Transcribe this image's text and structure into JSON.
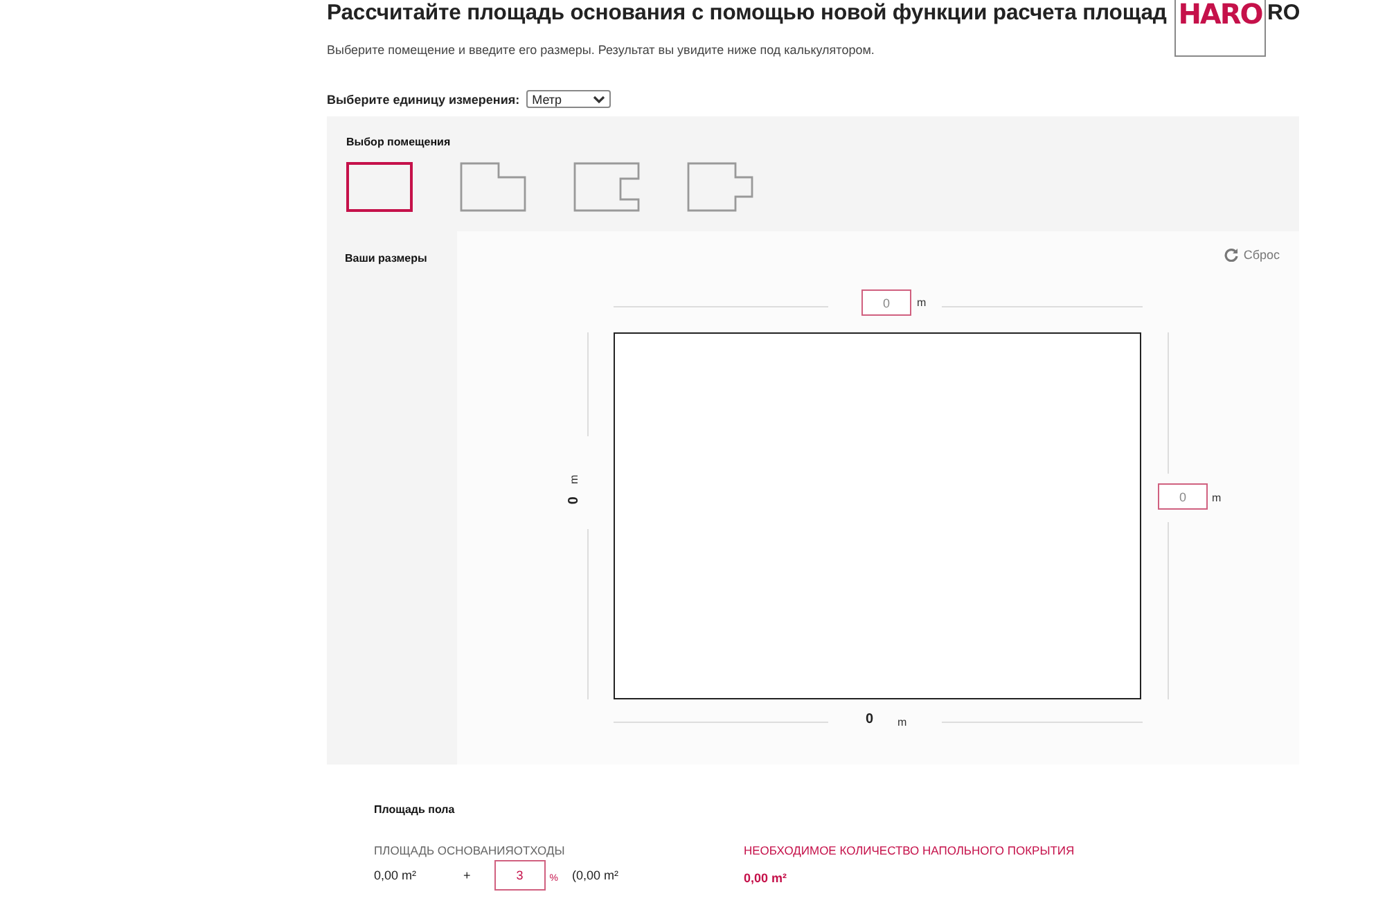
{
  "header": {
    "title": "Рассчитайте площадь основания с помощью новой функции расчета площад",
    "title_tail": "RO",
    "subtitle": "Выберите помещение и введите его размеры. Результат вы увидите ниже под калькулятором.",
    "logo": {
      "text": "HARO"
    }
  },
  "unit": {
    "label": "Выберите единицу измерения:",
    "value": "Метр"
  },
  "room_selection": {
    "title": "Выбор помещения",
    "rooms": [
      {
        "kind": "rectangle",
        "selected": true
      },
      {
        "kind": "corner",
        "selected": false
      },
      {
        "kind": "notch",
        "selected": false
      },
      {
        "kind": "bump",
        "selected": false
      }
    ]
  },
  "dimensions": {
    "title": "Ваши размеры",
    "reset": "Сброс",
    "top": {
      "value": "0",
      "unit": "m"
    },
    "left": {
      "value": "0",
      "unit": "m"
    },
    "right": {
      "value": "0",
      "unit": "m"
    },
    "bottom": {
      "value": "0",
      "unit": "m"
    }
  },
  "floor_area": {
    "title": "Площадь пола",
    "base_label": "ПЛОЩАДЬ ОСНОВАНИЯОТХОДЫ",
    "base_value": "0,00 m²",
    "plus": "+",
    "waste_value": "3",
    "waste_unit": "%",
    "waste_area": "(0,00 m²",
    "required_label": "НЕОБХОДИМОЕ КОЛИЧЕСТВО НАПОЛЬНОГО ПОКРЫТИЯ",
    "required_value": "0,00 m²"
  }
}
